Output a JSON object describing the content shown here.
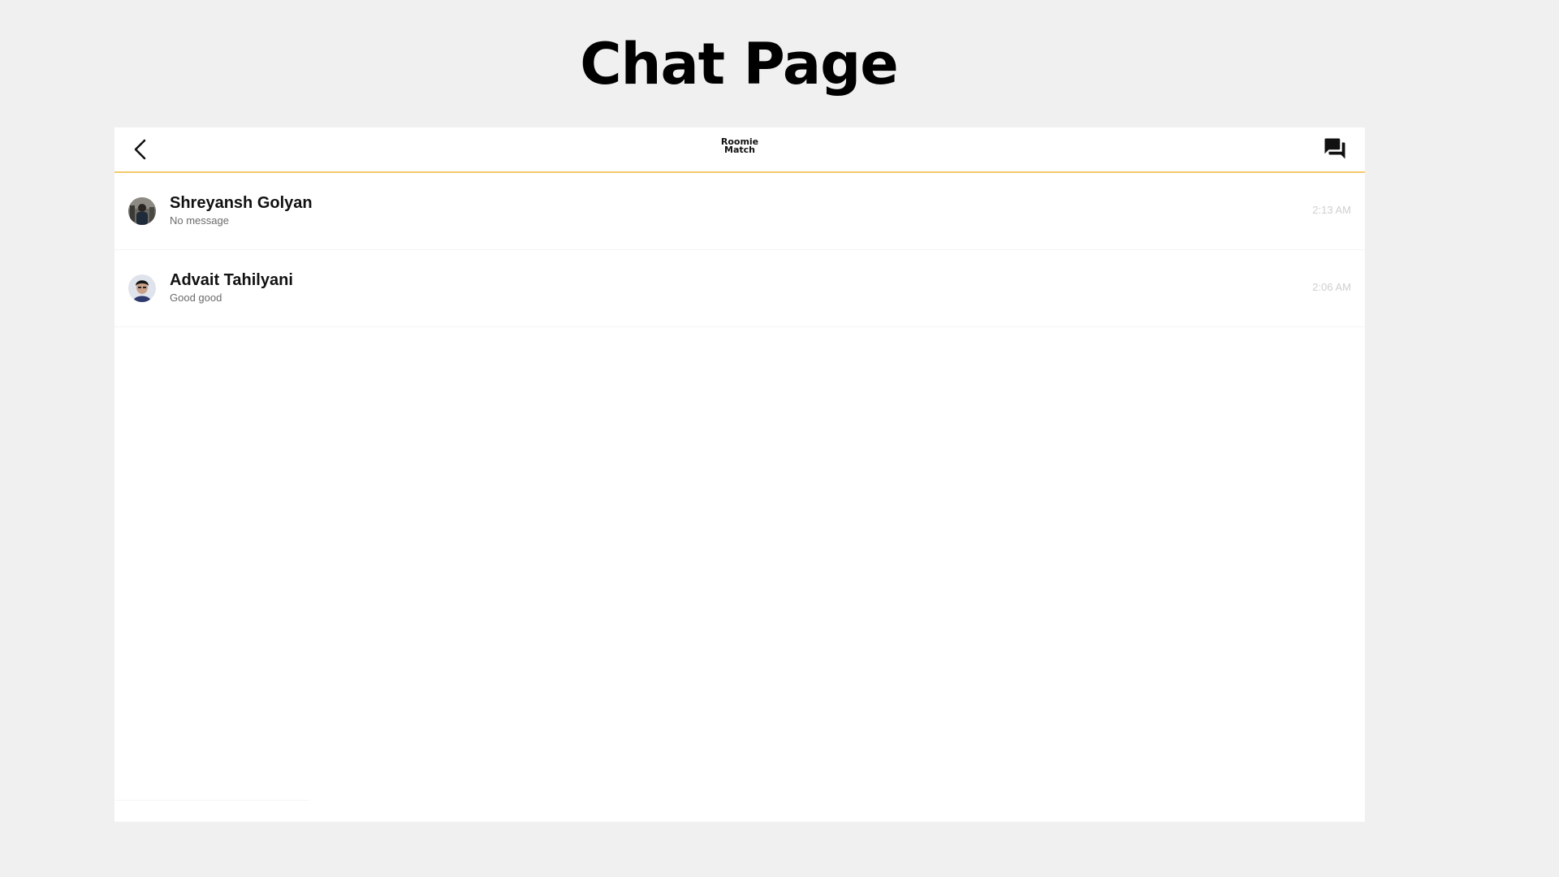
{
  "page": {
    "title": "Chat Page"
  },
  "header": {
    "back_icon": "chevron-left-icon",
    "logo_line1": "Roomie",
    "logo_line2": "Match",
    "chat_icon": "forum-icon",
    "accent_color": "#f3c969"
  },
  "chats": [
    {
      "name": "Shreyansh Golyan",
      "preview": "No message",
      "time": "2:13 AM"
    },
    {
      "name": "Advait Tahilyani",
      "preview": "Good good",
      "time": "2:06 AM"
    }
  ]
}
